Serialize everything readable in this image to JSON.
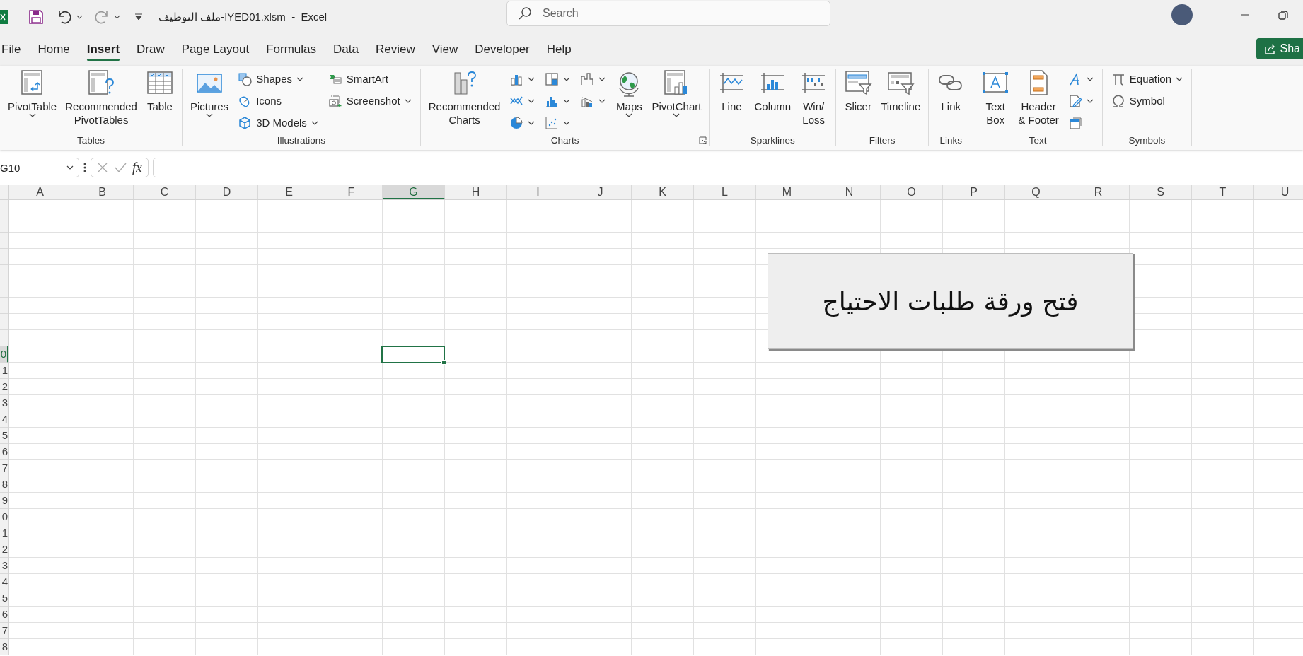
{
  "window": {
    "title": "ملف التوظيف-IYED01.xlsm  -  Excel",
    "search": {
      "placeholder": "Search"
    },
    "redo": {
      "disabled": true
    },
    "share_button": {
      "label": "Sha"
    }
  },
  "tabs": [
    {
      "label": "File",
      "selected": false
    },
    {
      "label": "Home",
      "selected": false
    },
    {
      "label": "Insert",
      "selected": true
    },
    {
      "label": "Draw",
      "selected": false
    },
    {
      "label": "Page Layout",
      "selected": false
    },
    {
      "label": "Formulas",
      "selected": false
    },
    {
      "label": "Data",
      "selected": false
    },
    {
      "label": "Review",
      "selected": false
    },
    {
      "label": "View",
      "selected": false
    },
    {
      "label": "Developer",
      "selected": false
    },
    {
      "label": "Help",
      "selected": false
    }
  ],
  "ribbon": {
    "groups": [
      {
        "label": "Tables",
        "items": [
          {
            "kind": "large",
            "label": "PivotTable",
            "dropdown": true
          },
          {
            "kind": "large",
            "label": "Recommended\nPivotTables",
            "dropdown": false
          },
          {
            "kind": "large",
            "label": "Table",
            "dropdown": false
          }
        ]
      },
      {
        "label": "Illustrations",
        "items": [
          {
            "kind": "large",
            "label": "Pictures",
            "dropdown": true
          },
          {
            "kind": "stack",
            "items": [
              {
                "kind": "small",
                "label": "Shapes",
                "dropdown": true
              },
              {
                "kind": "small",
                "label": "Icons",
                "dropdown": false
              },
              {
                "kind": "small",
                "label": "3D Models",
                "dropdown": true
              }
            ]
          },
          {
            "kind": "stack",
            "items": [
              {
                "kind": "small",
                "label": "SmartArt",
                "dropdown": false
              },
              {
                "kind": "small",
                "label": "Screenshot",
                "dropdown": true
              }
            ]
          }
        ]
      },
      {
        "label": "Charts",
        "launcher": true,
        "items": [
          {
            "kind": "large",
            "label": "Recommended\nCharts",
            "dropdown": false
          },
          {
            "kind": "stack",
            "items": [
              {
                "kind": "icon",
                "dropdown": true
              },
              {
                "kind": "icon",
                "dropdown": true
              },
              {
                "kind": "icon",
                "dropdown": true
              }
            ]
          },
          {
            "kind": "stack",
            "items": [
              {
                "kind": "icon",
                "dropdown": true
              },
              {
                "kind": "icon",
                "dropdown": true
              },
              {
                "kind": "icon",
                "dropdown": true
              }
            ]
          },
          {
            "kind": "stack",
            "items": [
              {
                "kind": "icon",
                "dropdown": true
              },
              {
                "kind": "icon",
                "dropdown": true
              }
            ]
          },
          {
            "kind": "large",
            "label": "Maps",
            "dropdown": true
          },
          {
            "kind": "large",
            "label": "PivotChart",
            "dropdown": true
          }
        ]
      },
      {
        "label": "Sparklines",
        "items": [
          {
            "kind": "large",
            "label": "Line",
            "dropdown": false
          },
          {
            "kind": "large",
            "label": "Column",
            "dropdown": false
          },
          {
            "kind": "large",
            "label": "Win/\nLoss",
            "dropdown": false
          }
        ]
      },
      {
        "label": "Filters",
        "items": [
          {
            "kind": "large",
            "label": "Slicer",
            "dropdown": false
          },
          {
            "kind": "large",
            "label": "Timeline",
            "dropdown": false
          }
        ]
      },
      {
        "label": "Links",
        "items": [
          {
            "kind": "large",
            "label": "Link",
            "dropdown": false
          }
        ]
      },
      {
        "label": "Text",
        "items": [
          {
            "kind": "large",
            "label": "Text\nBox",
            "dropdown": false
          },
          {
            "kind": "large",
            "label": "Header\n& Footer",
            "dropdown": false
          },
          {
            "kind": "stack",
            "items": [
              {
                "kind": "icon",
                "dropdown": true
              },
              {
                "kind": "icon",
                "dropdown": true
              },
              {
                "kind": "icon",
                "dropdown": false
              }
            ]
          }
        ]
      },
      {
        "label": "Symbols",
        "items": [
          {
            "kind": "stack",
            "items": [
              {
                "kind": "small",
                "label": "Equation",
                "dropdown": true
              },
              {
                "kind": "small",
                "label": "Symbol",
                "dropdown": false
              }
            ]
          }
        ]
      }
    ]
  },
  "formula_bar": {
    "name_box": "G10",
    "function_label": "fx",
    "edit_buttons_disabled": true
  },
  "sheet": {
    "columns": [
      {
        "label": "A",
        "selected": false
      },
      {
        "label": "B",
        "selected": false
      },
      {
        "label": "C",
        "selected": false
      },
      {
        "label": "D",
        "selected": false
      },
      {
        "label": "E",
        "selected": false
      },
      {
        "label": "F",
        "selected": false
      },
      {
        "label": "G",
        "selected": true
      },
      {
        "label": "H",
        "selected": false
      },
      {
        "label": "I",
        "selected": false
      },
      {
        "label": "J",
        "selected": false
      },
      {
        "label": "K",
        "selected": false
      },
      {
        "label": "L",
        "selected": false
      },
      {
        "label": "M",
        "selected": false
      },
      {
        "label": "N",
        "selected": false
      },
      {
        "label": "O",
        "selected": false
      },
      {
        "label": "P",
        "selected": false
      },
      {
        "label": "Q",
        "selected": false
      },
      {
        "label": "R",
        "selected": false
      },
      {
        "label": "S",
        "selected": false
      },
      {
        "label": "T",
        "selected": false
      },
      {
        "label": "U",
        "selected": false
      }
    ],
    "rows": [
      {
        "selected": false
      },
      {
        "selected": false
      },
      {
        "selected": false
      },
      {
        "selected": false
      },
      {
        "selected": false
      },
      {
        "selected": false
      },
      {
        "selected": false
      },
      {
        "selected": false
      },
      {
        "selected": false
      },
      {
        "label": "0",
        "selected": true
      },
      {
        "label": "1",
        "selected": false
      },
      {
        "label": "2",
        "selected": false
      },
      {
        "label": "3",
        "selected": false
      },
      {
        "label": "4",
        "selected": false
      },
      {
        "label": "5",
        "selected": false
      },
      {
        "label": "6",
        "selected": false
      },
      {
        "label": "7",
        "selected": false
      },
      {
        "label": "8",
        "selected": false
      },
      {
        "label": "9",
        "selected": false
      },
      {
        "label": "0",
        "selected": false
      },
      {
        "label": "1",
        "selected": false
      },
      {
        "label": "2",
        "selected": false
      },
      {
        "label": "3",
        "selected": false
      },
      {
        "label": "4",
        "selected": false
      },
      {
        "label": "5",
        "selected": false
      },
      {
        "label": "6",
        "selected": false
      },
      {
        "label": "7",
        "selected": false
      },
      {
        "label": "8",
        "selected": false
      }
    ],
    "shape_button": {
      "label": "فتح ورقة طلبات الاحتياج"
    }
  }
}
